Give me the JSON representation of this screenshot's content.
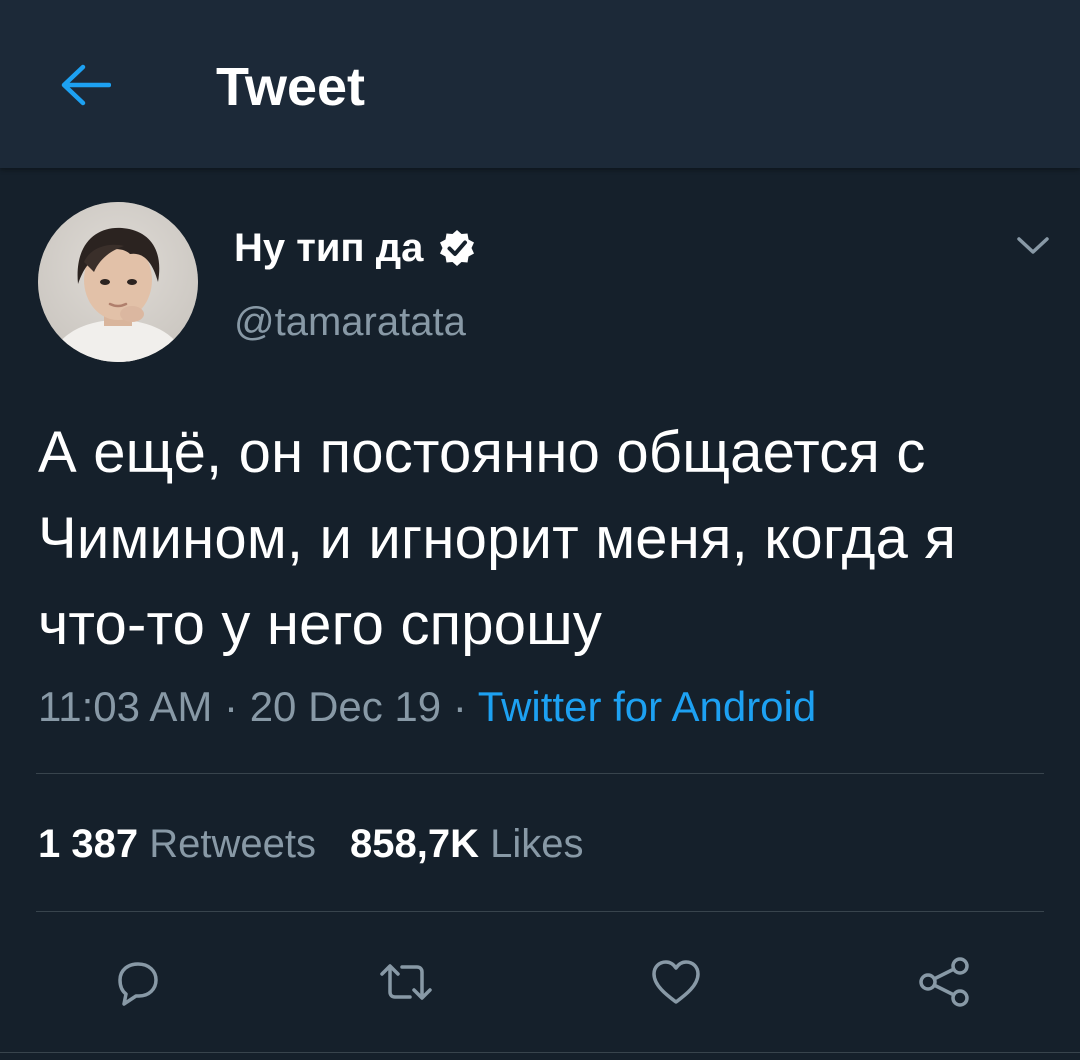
{
  "header": {
    "title": "Tweet",
    "back_icon": "arrow-left-icon"
  },
  "colors": {
    "background": "#15202b",
    "header_background": "#1c2938",
    "accent": "#1da1f2",
    "secondary_text": "#8899a6",
    "divider": "#38444d"
  },
  "author": {
    "display_name": "Ну тип да",
    "verified_icon": "verified-badge-icon",
    "handle": "@tamaratata",
    "menu_icon": "chevron-down-icon"
  },
  "tweet": {
    "text": "А ещё, он постоянно общается с Чимином, и игнорит меня, когда я что-то у него спрошу",
    "time": "11:03 AM",
    "separator": "·",
    "date": "20 Dec 19",
    "source": "Twitter for Android"
  },
  "stats": {
    "retweets_count": "1 387",
    "retweets_label": "Retweets",
    "likes_count": "858,7K",
    "likes_label": "Likes"
  },
  "actions": [
    {
      "icon": "reply-icon"
    },
    {
      "icon": "retweet-icon"
    },
    {
      "icon": "like-icon"
    },
    {
      "icon": "share-icon"
    }
  ]
}
